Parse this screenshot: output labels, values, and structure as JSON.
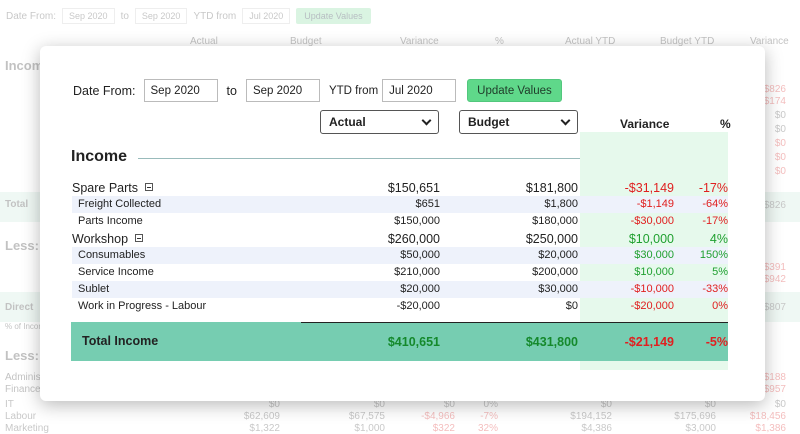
{
  "background": {
    "toolbar": {
      "date_from_label": "Date From:",
      "date_from": "Sep 2020",
      "to_label": "to",
      "date_to": "Sep 2020",
      "ytd_label": "YTD from",
      "ytd_from": "Jul 2020",
      "button": "Update Values"
    },
    "headers": [
      "Actual",
      "Budget",
      "Variance",
      "%",
      "Actual YTD",
      "Budget YTD",
      "Variance"
    ],
    "section_income": "Income",
    "section_less1": "Less:",
    "section_less2": "Less:",
    "total_label": "Total",
    "direct_label": "Direct",
    "pct_income_label": "% of Income",
    "right_values": [
      "$826",
      "$174",
      "$0",
      "$0",
      "$0",
      "$0",
      "$0",
      "$826",
      "$391",
      "$942",
      "$807",
      "$188",
      "$957"
    ],
    "rows": [
      {
        "label": "IT",
        "v1": "$0",
        "v2": "$0",
        "v3": "$0",
        "v4": "0%",
        "v5": "$0",
        "v6": "$0",
        "v7": "$0"
      },
      {
        "label": "Labour",
        "v1": "$62,609",
        "v2": "$67,575",
        "v3": "-$4,966",
        "v4": "-7%",
        "v5": "$194,152",
        "v6": "$175,696",
        "v7": "$18,456"
      },
      {
        "label": "Marketing",
        "v1": "$1,322",
        "v2": "$1,000",
        "v3": "$322",
        "v4": "32%",
        "v5": "$4,386",
        "v6": "$3,000",
        "v7": "$1,386"
      }
    ],
    "admin_labels": [
      "Administ",
      "Finance"
    ]
  },
  "toolbar": {
    "date_from_label": "Date From:",
    "date_from": "Sep 2020",
    "to_label": "to",
    "date_to": "Sep 2020",
    "ytd_label": "YTD from",
    "ytd_from": "Jul 2020",
    "update_button": "Update Values"
  },
  "columns": {
    "actual_select": "Actual",
    "budget_select": "Budget",
    "variance": "Variance",
    "percent": "%"
  },
  "section_title": "Income",
  "rows": [
    {
      "label": "Spare Parts",
      "actual": "$150,651",
      "budget": "$181,800",
      "variance": "-$31,149",
      "pct": "-17%",
      "parent": true,
      "vsign": "neg",
      "psign": "neg"
    },
    {
      "label": "Freight Collected",
      "actual": "$651",
      "budget": "$1,800",
      "variance": "-$1,149",
      "pct": "-64%",
      "parent": false,
      "vsign": "neg",
      "psign": "neg"
    },
    {
      "label": "Parts Income",
      "actual": "$150,000",
      "budget": "$180,000",
      "variance": "-$30,000",
      "pct": "-17%",
      "parent": false,
      "vsign": "neg",
      "psign": "neg"
    },
    {
      "label": "Workshop",
      "actual": "$260,000",
      "budget": "$250,000",
      "variance": "$10,000",
      "pct": "4%",
      "parent": true,
      "vsign": "pos",
      "psign": "pos"
    },
    {
      "label": "Consumables",
      "actual": "$50,000",
      "budget": "$20,000",
      "variance": "$30,000",
      "pct": "150%",
      "parent": false,
      "vsign": "pos",
      "psign": "pos"
    },
    {
      "label": "Service Income",
      "actual": "$210,000",
      "budget": "$200,000",
      "variance": "$10,000",
      "pct": "5%",
      "parent": false,
      "vsign": "pos",
      "psign": "pos"
    },
    {
      "label": "Sublet",
      "actual": "$20,000",
      "budget": "$30,000",
      "variance": "-$10,000",
      "pct": "-33%",
      "parent": false,
      "vsign": "neg",
      "psign": "neg"
    },
    {
      "label": "Work in Progress - Labour",
      "actual": "-$20,000",
      "budget": "$0",
      "variance": "-$20,000",
      "pct": "0%",
      "parent": false,
      "vsign": "neg",
      "psign": "neg"
    }
  ],
  "total": {
    "label": "Total Income",
    "actual": "$410,651",
    "budget": "$431,800",
    "variance": "-$21,149",
    "pct": "-5%"
  },
  "colors": {
    "variance_band": "#e6f9ec",
    "total_band": "#76cdb1",
    "button": "#5fd88a",
    "negative": "#e02020",
    "positive": "#20a030"
  }
}
